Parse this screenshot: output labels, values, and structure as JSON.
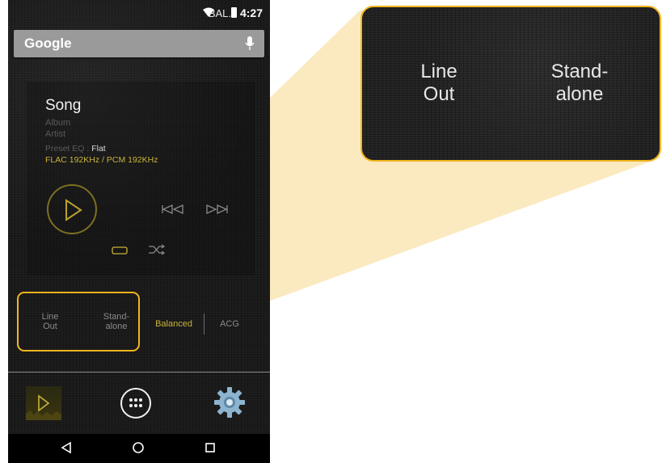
{
  "status_bar": {
    "indicator": "BAL.",
    "time": "4:27",
    "icons": [
      "wifi-icon",
      "battery-icon"
    ]
  },
  "search": {
    "logo": "Google",
    "icon": "mic-icon"
  },
  "track": {
    "title": "Song",
    "album": "Album",
    "artist": "Artist",
    "preset_label": "Preset EQ :",
    "preset_value": "Flat",
    "format": "FLAC 192KHz / PCM 192KHz"
  },
  "controls": [
    "play-icon",
    "previous-icon",
    "next-icon",
    "repeat-icon",
    "shuffle-icon"
  ],
  "output_modes": {
    "line_out": [
      "Line",
      "Out"
    ],
    "standalone": [
      "Stand-",
      "alone"
    ],
    "balanced": "Balanced",
    "acg": "ACG"
  },
  "zoom": {
    "line_out": [
      "Line",
      "Out"
    ],
    "standalone": [
      "Stand-",
      "alone"
    ]
  },
  "dock": [
    "music-player-icon",
    "app-drawer-icon",
    "settings-icon"
  ],
  "nav": [
    "back-icon",
    "home-icon",
    "recents-icon"
  ],
  "colors": {
    "accent": "#f2b51e",
    "gold_text": "#c9b33a",
    "background": "#1a1a1a"
  }
}
